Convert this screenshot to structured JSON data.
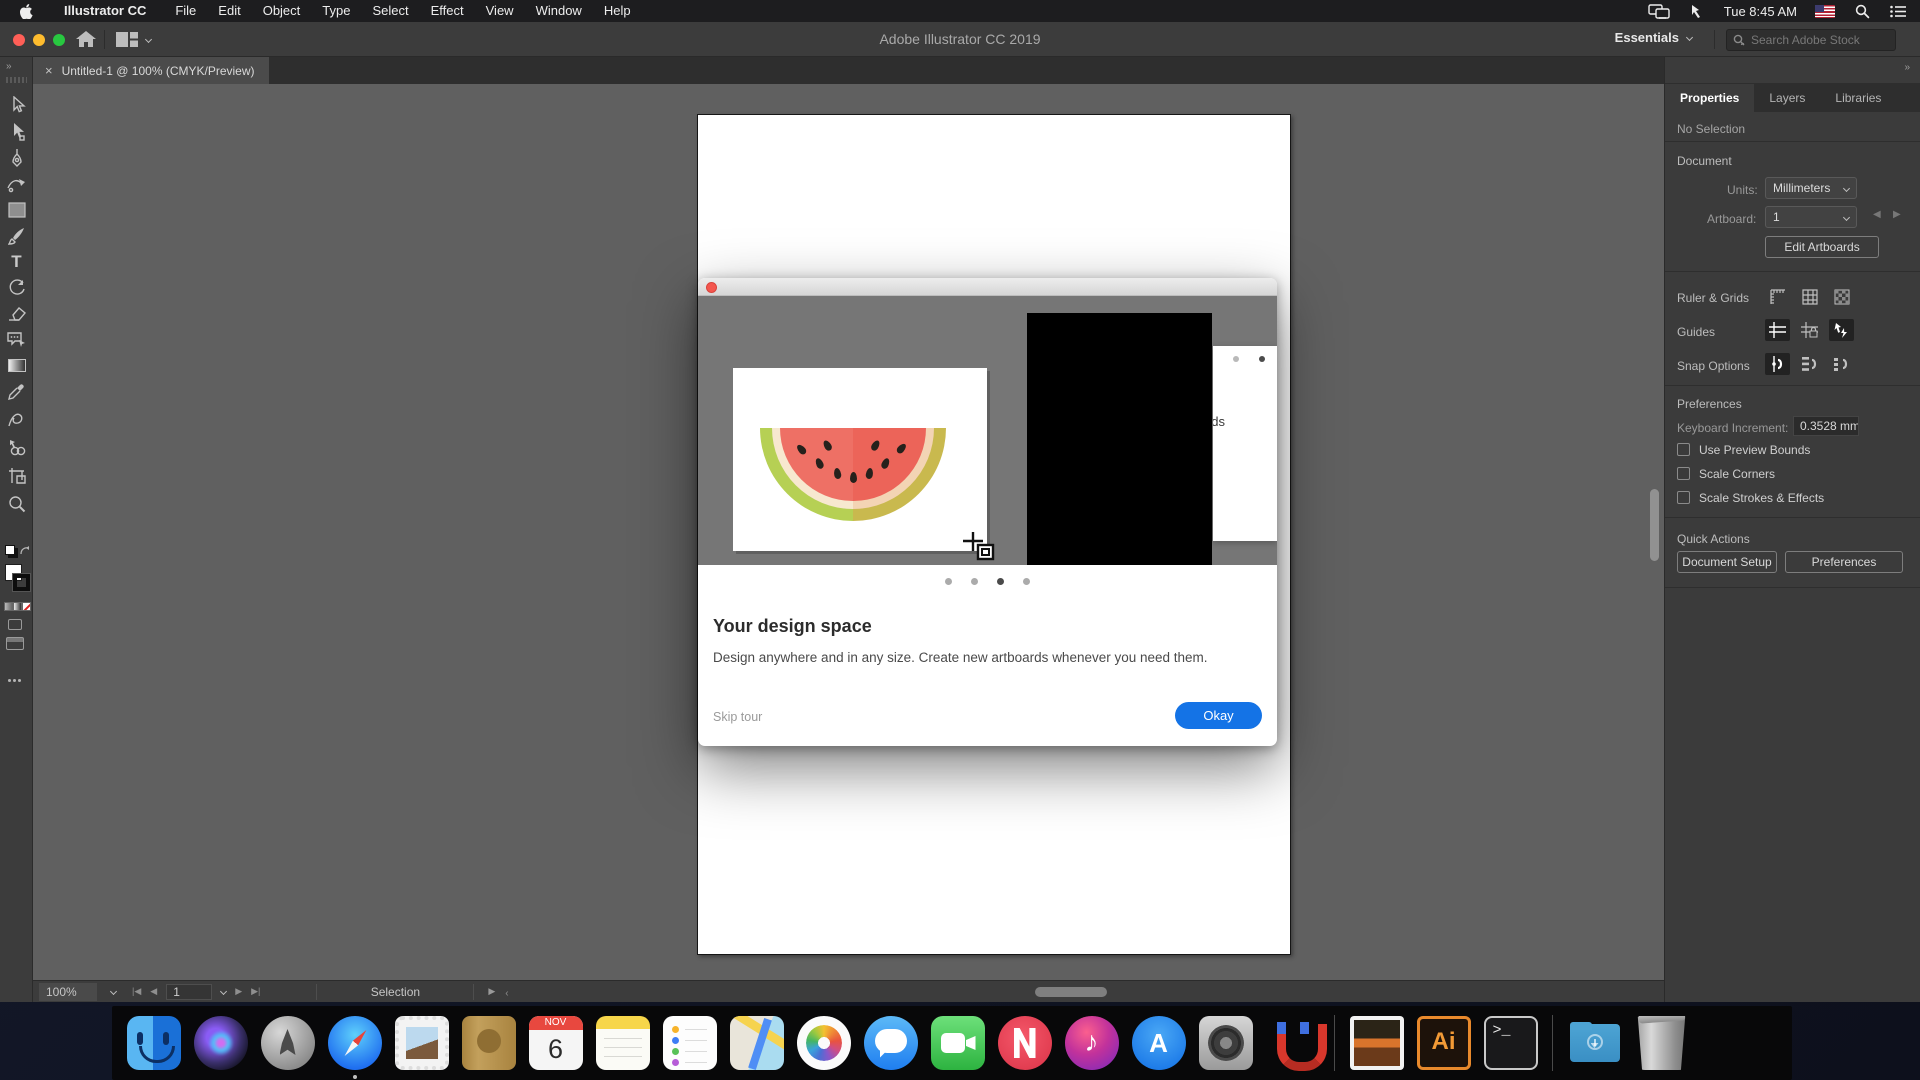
{
  "menubar": {
    "app_menu": "Illustrator CC",
    "items": [
      "File",
      "Edit",
      "Object",
      "Type",
      "Select",
      "Effect",
      "View",
      "Window",
      "Help"
    ],
    "time": "Tue 8:45 AM"
  },
  "titlebar": {
    "title": "Adobe Illustrator CC 2019",
    "workspace": "Essentials",
    "search_placeholder": "Search Adobe Stock"
  },
  "tabbar": {
    "document_tab": "Untitled-1 @ 100% (CMYK/Preview)",
    "close_glyph": "×"
  },
  "toolstrip": {
    "expand_glyph": "»",
    "tools": [
      "selection",
      "direct-selection",
      "pen",
      "curvature",
      "rectangle",
      "paintbrush",
      "type",
      "rotate",
      "eraser",
      "comment",
      "gradient-tool",
      "eyedropper",
      "width",
      "shape-builder",
      "artboard",
      "zoom"
    ],
    "type_glyph": "T"
  },
  "dialog": {
    "heading": "Your design space",
    "body": "Design anywhere and in any size. Create new artboards whenever you need them.",
    "skip_label": "Skip tour",
    "okay_label": "Okay",
    "okay_color": "#1473e6",
    "card_text": "Create new artboards",
    "page_dots": {
      "count": 4,
      "active_index": 3
    }
  },
  "statusbar": {
    "zoom": "100%",
    "artboard_number": "1",
    "tool": "Selection"
  },
  "panel": {
    "expand_glyph": "»",
    "tabs": [
      "Properties",
      "Layers",
      "Libraries"
    ],
    "no_selection": "No Selection",
    "document": {
      "title": "Document",
      "units_label": "Units:",
      "units_value": "Millimeters",
      "artboard_label": "Artboard:",
      "artboard_value": "1",
      "edit_artboards": "Edit Artboards"
    },
    "ruler_grids_label": "Ruler & Grids",
    "guides_label": "Guides",
    "snap_label": "Snap Options",
    "preferences": {
      "title": "Preferences",
      "keyboard_increment_label": "Keyboard Increment:",
      "keyboard_increment_value": "0.3528 mm",
      "checkbox_1": "Use Preview Bounds",
      "checkbox_2": "Scale Corners",
      "checkbox_3": "Scale Strokes & Effects"
    },
    "quick_actions": {
      "title": "Quick Actions",
      "button_1": "Document Setup",
      "button_2": "Preferences"
    }
  },
  "dock": {
    "items": [
      "finder",
      "siri",
      "launchpad",
      "safari",
      "mail",
      "contacts",
      "calendar",
      "notes",
      "reminders",
      "maps",
      "photos",
      "messages",
      "facetime",
      "news",
      "itunes",
      "app-store",
      "system-preferences",
      "magnet",
      "wallpaper",
      "illustrator",
      "terminal",
      "downloads",
      "trash"
    ],
    "running": [
      "finder",
      "safari",
      "illustrator"
    ],
    "calendar_month": "NOV",
    "calendar_day": "6",
    "illustrator_glyph": "Ai",
    "terminal_glyph": ">_"
  }
}
